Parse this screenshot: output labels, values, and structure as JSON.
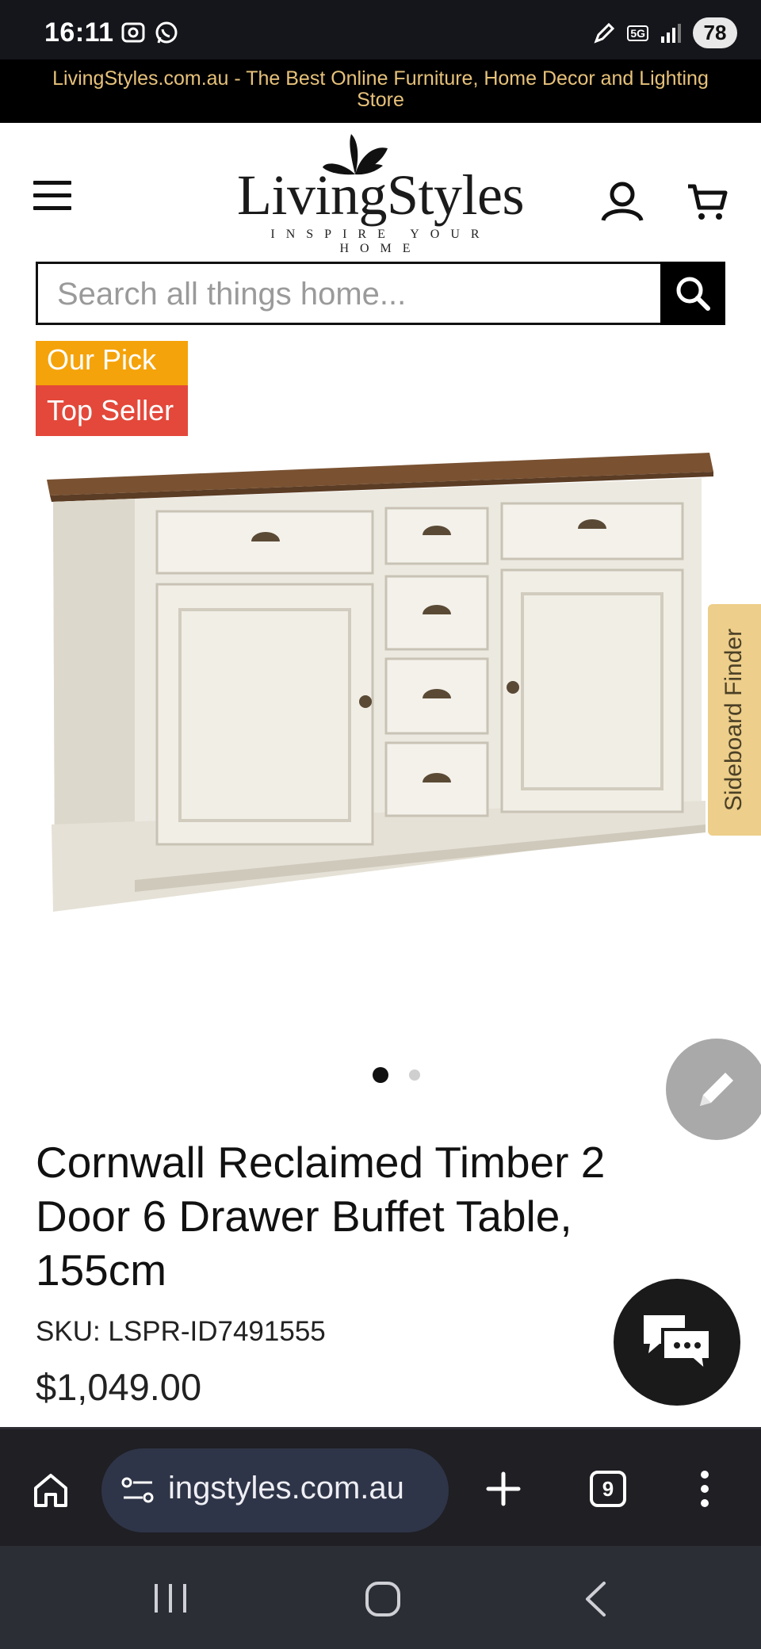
{
  "status_bar": {
    "time": "16:11",
    "network": "5G",
    "battery": "78"
  },
  "promo_banner": {
    "text": "LivingStyles.com.au - The Best Online Furniture, Home Decor and Lighting Store"
  },
  "header": {
    "logo_name": "LivingStyles",
    "logo_tagline": "INSPIRE YOUR HOME"
  },
  "search": {
    "placeholder": "Search all things home..."
  },
  "badges": {
    "our_pick": "Our Pick",
    "top_seller": "Top Seller"
  },
  "sideboard_finder": {
    "label": "Sideboard Finder"
  },
  "carousel": {
    "current": 1,
    "total": 2
  },
  "product": {
    "title": "Cornwall Reclaimed Timber 2 Door 6 Drawer Buffet Table, 155cm",
    "sku": "SKU: LSPR-ID7491555",
    "price": "$1,049.00"
  },
  "browser": {
    "url": "ingstyles.com.au",
    "tab_count": "9"
  },
  "colors": {
    "badge_our_pick": "#f5a30a",
    "badge_top_seller": "#e3483a",
    "sideboard_finder_bg": "#edce8a",
    "banner_text": "#e7c27a",
    "url_pill_bg": "#2f3548",
    "chat_fab_bg": "#1a1a1a",
    "edit_fab_bg": "#a9a9a9"
  }
}
